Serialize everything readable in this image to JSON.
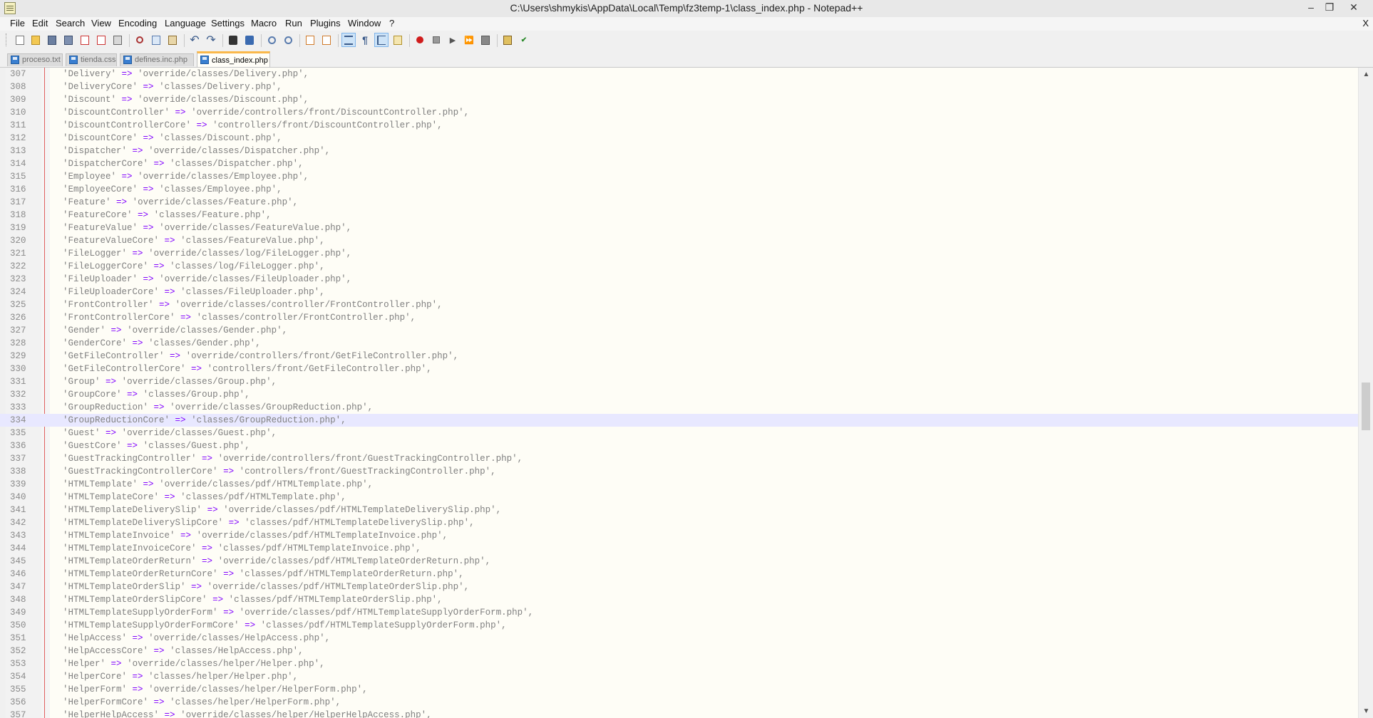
{
  "window": {
    "title": "C:\\Users\\shmykis\\AppData\\Local\\Temp\\fz3temp-1\\class_index.php - Notepad++",
    "minimize_glyph": "–",
    "restore_glyph": "❐",
    "close_glyph": "✕"
  },
  "menu": {
    "items": [
      "File",
      "Edit",
      "Search",
      "View",
      "Encoding",
      "Language",
      "Settings",
      "Macro",
      "Run",
      "Plugins",
      "Window",
      "?"
    ],
    "close_doc": "X"
  },
  "toolbar": {
    "buttons": [
      {
        "icon": "new-file-icon"
      },
      {
        "icon": "open-file-icon"
      },
      {
        "icon": "save-icon"
      },
      {
        "icon": "save-all-icon"
      },
      {
        "icon": "close-icon"
      },
      {
        "icon": "close-all-icon"
      },
      {
        "icon": "print-icon"
      },
      {
        "icon": "cut-icon"
      },
      {
        "icon": "copy-icon"
      },
      {
        "icon": "paste-icon"
      },
      {
        "icon": "undo-icon"
      },
      {
        "icon": "redo-icon"
      },
      {
        "icon": "find-icon"
      },
      {
        "icon": "replace-icon"
      },
      {
        "icon": "zoom-in-icon"
      },
      {
        "icon": "zoom-out-icon"
      },
      {
        "icon": "sync-vertical-icon"
      },
      {
        "icon": "sync-horizontal-icon"
      },
      {
        "icon": "word-wrap-icon",
        "active": true
      },
      {
        "icon": "show-all-chars-icon"
      },
      {
        "icon": "indent-guide-icon",
        "active": true
      },
      {
        "icon": "doc-map-icon"
      },
      {
        "icon": "record-macro-icon"
      },
      {
        "icon": "stop-record-icon"
      },
      {
        "icon": "playback-macro-icon"
      },
      {
        "icon": "run-macro-multiple-icon"
      },
      {
        "icon": "save-macro-icon"
      },
      {
        "icon": "monitoring-icon"
      },
      {
        "icon": "spellcheck-icon"
      }
    ]
  },
  "tabs": [
    {
      "label": "proceso.txt",
      "active": false
    },
    {
      "label": "tienda.css",
      "active": false
    },
    {
      "label": "defines.inc.php",
      "active": false
    },
    {
      "label": "class_index.php",
      "active": true
    }
  ],
  "editor": {
    "current_line": 334,
    "lines": [
      {
        "n": "307",
        "key": "'Delivery'",
        "val": "'override/classes/Delivery.php',"
      },
      {
        "n": "308",
        "key": "'DeliveryCore'",
        "val": "'classes/Delivery.php',"
      },
      {
        "n": "309",
        "key": "'Discount'",
        "val": "'override/classes/Discount.php',"
      },
      {
        "n": "310",
        "key": "'DiscountController'",
        "val": "'override/controllers/front/DiscountController.php',"
      },
      {
        "n": "311",
        "key": "'DiscountControllerCore'",
        "val": "'controllers/front/DiscountController.php',"
      },
      {
        "n": "312",
        "key": "'DiscountCore'",
        "val": "'classes/Discount.php',"
      },
      {
        "n": "313",
        "key": "'Dispatcher'",
        "val": "'override/classes/Dispatcher.php',"
      },
      {
        "n": "314",
        "key": "'DispatcherCore'",
        "val": "'classes/Dispatcher.php',"
      },
      {
        "n": "315",
        "key": "'Employee'",
        "val": "'override/classes/Employee.php',"
      },
      {
        "n": "316",
        "key": "'EmployeeCore'",
        "val": "'classes/Employee.php',"
      },
      {
        "n": "317",
        "key": "'Feature'",
        "val": "'override/classes/Feature.php',"
      },
      {
        "n": "318",
        "key": "'FeatureCore'",
        "val": "'classes/Feature.php',"
      },
      {
        "n": "319",
        "key": "'FeatureValue'",
        "val": "'override/classes/FeatureValue.php',"
      },
      {
        "n": "320",
        "key": "'FeatureValueCore'",
        "val": "'classes/FeatureValue.php',"
      },
      {
        "n": "321",
        "key": "'FileLogger'",
        "val": "'override/classes/log/FileLogger.php',"
      },
      {
        "n": "322",
        "key": "'FileLoggerCore'",
        "val": "'classes/log/FileLogger.php',"
      },
      {
        "n": "323",
        "key": "'FileUploader'",
        "val": "'override/classes/FileUploader.php',"
      },
      {
        "n": "324",
        "key": "'FileUploaderCore'",
        "val": "'classes/FileUploader.php',"
      },
      {
        "n": "325",
        "key": "'FrontController'",
        "val": "'override/classes/controller/FrontController.php',"
      },
      {
        "n": "326",
        "key": "'FrontControllerCore'",
        "val": "'classes/controller/FrontController.php',"
      },
      {
        "n": "327",
        "key": "'Gender'",
        "val": "'override/classes/Gender.php',"
      },
      {
        "n": "328",
        "key": "'GenderCore'",
        "val": "'classes/Gender.php',"
      },
      {
        "n": "329",
        "key": "'GetFileController'",
        "val": "'override/controllers/front/GetFileController.php',"
      },
      {
        "n": "330",
        "key": "'GetFileControllerCore'",
        "val": "'controllers/front/GetFileController.php',"
      },
      {
        "n": "331",
        "key": "'Group'",
        "val": "'override/classes/Group.php',"
      },
      {
        "n": "332",
        "key": "'GroupCore'",
        "val": "'classes/Group.php',"
      },
      {
        "n": "333",
        "key": "'GroupReduction'",
        "val": "'override/classes/GroupReduction.php',"
      },
      {
        "n": "334",
        "key": "'GroupReductionCore'",
        "val": "'classes/GroupReduction.php',"
      },
      {
        "n": "335",
        "key": "'Guest'",
        "val": "'override/classes/Guest.php',"
      },
      {
        "n": "336",
        "key": "'GuestCore'",
        "val": "'classes/Guest.php',"
      },
      {
        "n": "337",
        "key": "'GuestTrackingController'",
        "val": "'override/controllers/front/GuestTrackingController.php',"
      },
      {
        "n": "338",
        "key": "'GuestTrackingControllerCore'",
        "val": "'controllers/front/GuestTrackingController.php',"
      },
      {
        "n": "339",
        "key": "'HTMLTemplate'",
        "val": "'override/classes/pdf/HTMLTemplate.php',"
      },
      {
        "n": "340",
        "key": "'HTMLTemplateCore'",
        "val": "'classes/pdf/HTMLTemplate.php',"
      },
      {
        "n": "341",
        "key": "'HTMLTemplateDeliverySlip'",
        "val": "'override/classes/pdf/HTMLTemplateDeliverySlip.php',"
      },
      {
        "n": "342",
        "key": "'HTMLTemplateDeliverySlipCore'",
        "val": "'classes/pdf/HTMLTemplateDeliverySlip.php',"
      },
      {
        "n": "343",
        "key": "'HTMLTemplateInvoice'",
        "val": "'override/classes/pdf/HTMLTemplateInvoice.php',"
      },
      {
        "n": "344",
        "key": "'HTMLTemplateInvoiceCore'",
        "val": "'classes/pdf/HTMLTemplateInvoice.php',"
      },
      {
        "n": "345",
        "key": "'HTMLTemplateOrderReturn'",
        "val": "'override/classes/pdf/HTMLTemplateOrderReturn.php',"
      },
      {
        "n": "346",
        "key": "'HTMLTemplateOrderReturnCore'",
        "val": "'classes/pdf/HTMLTemplateOrderReturn.php',"
      },
      {
        "n": "347",
        "key": "'HTMLTemplateOrderSlip'",
        "val": "'override/classes/pdf/HTMLTemplateOrderSlip.php',"
      },
      {
        "n": "348",
        "key": "'HTMLTemplateOrderSlipCore'",
        "val": "'classes/pdf/HTMLTemplateOrderSlip.php',"
      },
      {
        "n": "349",
        "key": "'HTMLTemplateSupplyOrderForm'",
        "val": "'override/classes/pdf/HTMLTemplateSupplyOrderForm.php',"
      },
      {
        "n": "350",
        "key": "'HTMLTemplateSupplyOrderFormCore'",
        "val": "'classes/pdf/HTMLTemplateSupplyOrderForm.php',"
      },
      {
        "n": "351",
        "key": "'HelpAccess'",
        "val": "'override/classes/HelpAccess.php',"
      },
      {
        "n": "352",
        "key": "'HelpAccessCore'",
        "val": "'classes/HelpAccess.php',"
      },
      {
        "n": "353",
        "key": "'Helper'",
        "val": "'override/classes/helper/Helper.php',"
      },
      {
        "n": "354",
        "key": "'HelperCore'",
        "val": "'classes/helper/Helper.php',"
      },
      {
        "n": "355",
        "key": "'HelperForm'",
        "val": "'override/classes/helper/HelperForm.php',"
      },
      {
        "n": "356",
        "key": "'HelperFormCore'",
        "val": "'classes/helper/HelperForm.php',"
      },
      {
        "n": "357",
        "key": "'HelperHelpAccess'",
        "val": "'override/classes/helper/HelperHelpAccess.php',"
      }
    ],
    "operator": "=>"
  },
  "colors": {
    "operator": "#8000ff",
    "string": "#808080",
    "current_line_bg": "#e8e8ff",
    "active_tab_accent": "#fab84a"
  },
  "scrollbar": {
    "up_glyph": "▲",
    "down_glyph": "▼"
  }
}
